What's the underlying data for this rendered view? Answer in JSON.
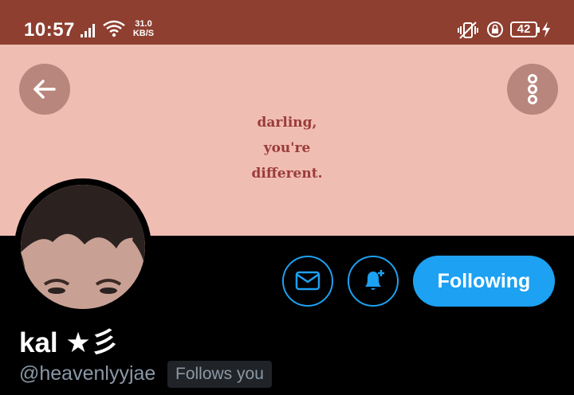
{
  "status_bar": {
    "time": "10:57",
    "net_speed_value": "31.0",
    "net_speed_unit": "KB/S",
    "battery_level": "42",
    "background_color": "#8e3f30",
    "icons": [
      "signal-icon",
      "wifi-icon",
      "vibrate-off-icon",
      "rotation-lock-icon",
      "battery-icon",
      "charging-bolt-icon"
    ]
  },
  "header": {
    "banner_color": "#f0bdb3",
    "banner_quote": [
      "darling,",
      "you're",
      "different."
    ],
    "back_icon": "arrow-left-icon",
    "more_icon": "more-vertical-icon"
  },
  "profile": {
    "display_name": "kal ★彡",
    "handle": "@heavenlyyjae",
    "follows_you_label": "Follows you",
    "actions": {
      "message_icon": "envelope-icon",
      "notify_icon": "bell-plus-icon",
      "following_label": "Following"
    },
    "accent_color": "#1da1f2"
  }
}
